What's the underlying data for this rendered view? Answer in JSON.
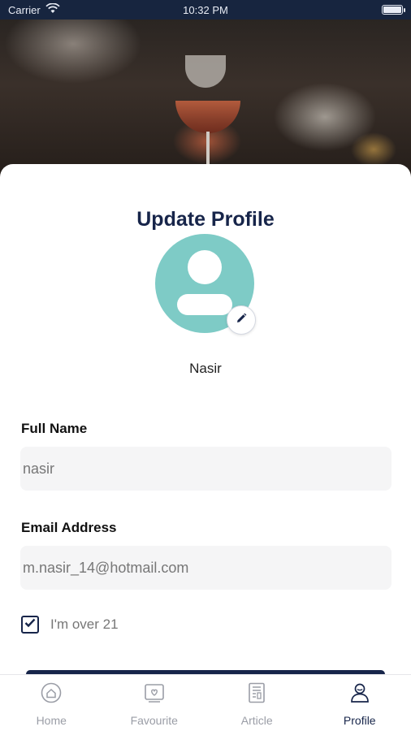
{
  "status_bar": {
    "carrier": "Carrier",
    "time": "10:32 PM"
  },
  "page": {
    "title": "Update Profile"
  },
  "profile": {
    "name": "Nasir"
  },
  "form": {
    "full_name": {
      "label": "Full Name",
      "value": "nasir"
    },
    "email": {
      "label": "Email Address",
      "value": "m.nasir_14@hotmail.com"
    },
    "age_checkbox": {
      "label": "I'm over 21",
      "checked": true
    }
  },
  "nav": {
    "items": [
      {
        "label": "Home",
        "icon": "home-icon",
        "active": false
      },
      {
        "label": "Favourite",
        "icon": "favourite-icon",
        "active": false
      },
      {
        "label": "Article",
        "icon": "article-icon",
        "active": false
      },
      {
        "label": "Profile",
        "icon": "profile-icon",
        "active": true
      }
    ]
  },
  "colors": {
    "primary": "#17254a",
    "avatar_bg": "#7ecbc6",
    "input_bg": "#f5f5f6"
  }
}
